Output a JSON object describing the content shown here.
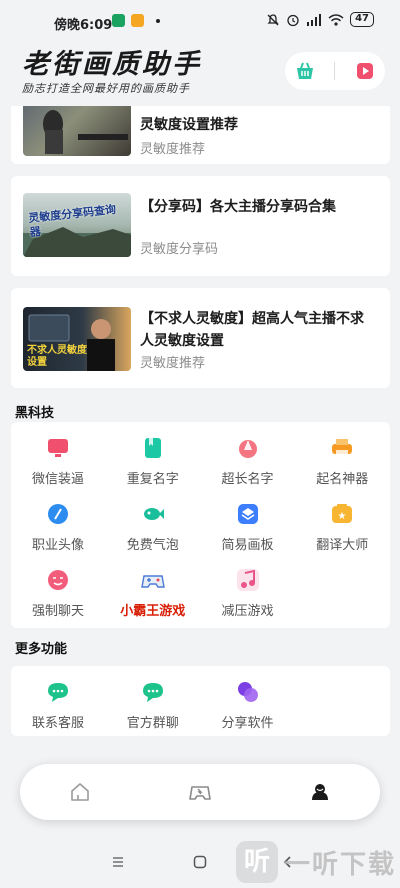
{
  "status_bar": {
    "time": "傍晚6:09",
    "battery": "47"
  },
  "header": {
    "title": "老街画质助手",
    "subtitle": "励志打造全网最好用的画质助手"
  },
  "articles": [
    {
      "title": "灵敏度设置推荐",
      "tag": "灵敏度推荐"
    },
    {
      "title": "【分享码】各大主播分享码合集",
      "tag": "灵敏度分享码",
      "thumb_text": "灵敏度分享码查询器"
    },
    {
      "title": "【不求人灵敏度】超高人气主播不求人灵敏度设置",
      "tag": "灵敏度推荐",
      "thumb_text": "不求人灵敏度设置"
    }
  ],
  "black_tech": {
    "title": "黑科技",
    "items": [
      {
        "label": "微信装逼",
        "icon": "monitor-icon",
        "color": "#f0506e"
      },
      {
        "label": "重复名字",
        "icon": "bookmark-icon",
        "color": "#1dc8a5"
      },
      {
        "label": "超长名字",
        "icon": "cone-icon",
        "color": "#f25d6b"
      },
      {
        "label": "起名神器",
        "icon": "printer-icon",
        "color": "#f59a23"
      },
      {
        "label": "职业头像",
        "icon": "pen-icon",
        "color": "#2d8cf0"
      },
      {
        "label": "免费气泡",
        "icon": "fish-icon",
        "color": "#19be9b"
      },
      {
        "label": "简易画板",
        "icon": "layers-icon",
        "color": "#3d7eff"
      },
      {
        "label": "翻译大师",
        "icon": "translate-icon",
        "color": "#f7b531"
      },
      {
        "label": "强制聊天",
        "icon": "chat-face-icon",
        "color": "#f25d7b"
      },
      {
        "label": "小霸王游戏",
        "icon": "gamepad-icon",
        "color": "#4a7bd5"
      },
      {
        "label": "减压游戏",
        "icon": "music-note-icon",
        "color": "#e9558a"
      }
    ]
  },
  "more": {
    "title": "更多功能",
    "items": [
      {
        "label": "联系客服",
        "icon": "support-chat-icon",
        "color": "#1ec28b"
      },
      {
        "label": "官方群聊",
        "icon": "group-chat-icon",
        "color": "#1ec28b"
      },
      {
        "label": "分享软件",
        "icon": "share-icon",
        "color": "#7b3fe4"
      }
    ]
  },
  "tabs": [
    "home-tab",
    "game-tab",
    "profile-tab"
  ],
  "watermark": {
    "logo": "听",
    "text": "一听下载"
  }
}
